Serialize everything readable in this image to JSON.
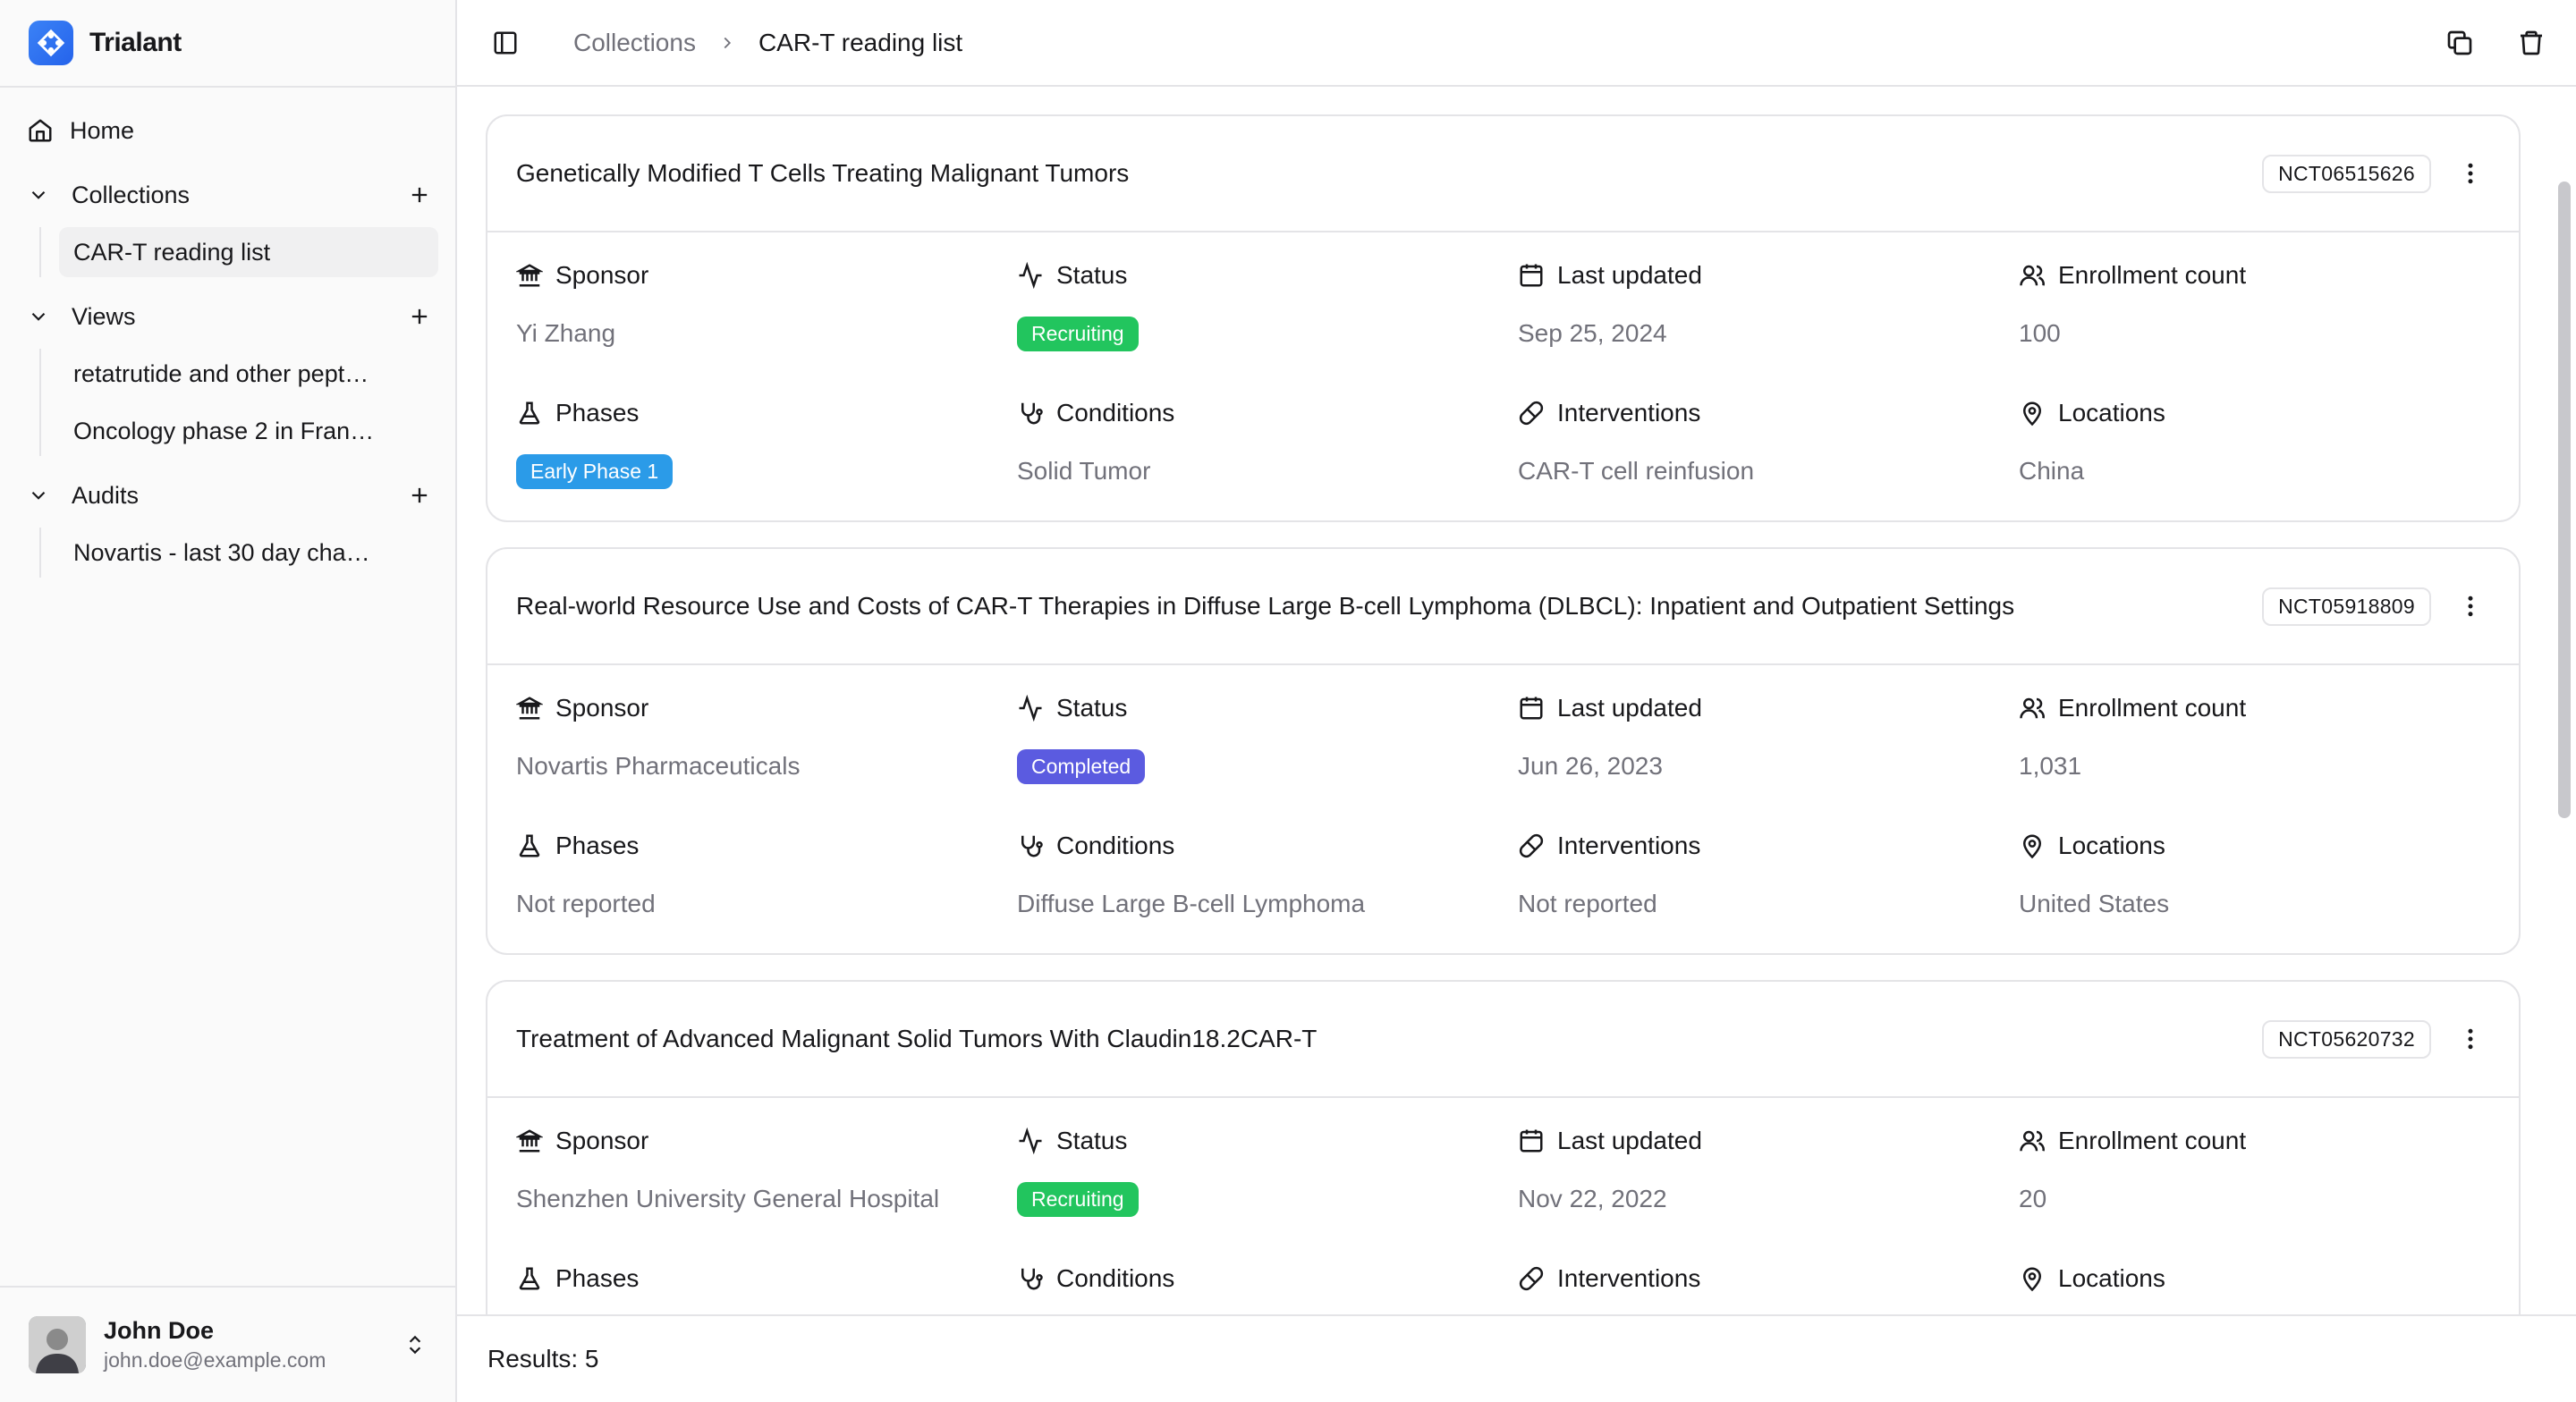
{
  "app": {
    "name": "Trialant"
  },
  "sidebar": {
    "home_label": "Home",
    "sections": [
      {
        "label": "Collections",
        "items": [
          "CAR-T reading list"
        ]
      },
      {
        "label": "Views",
        "items": [
          "retatrutide and other pept…",
          "Oncology phase 2 in Fran…"
        ]
      },
      {
        "label": "Audits",
        "items": [
          "Novartis - last 30 day cha…"
        ]
      }
    ]
  },
  "user": {
    "name": "John Doe",
    "email": "john.doe@example.com"
  },
  "breadcrumb": {
    "parent": "Collections",
    "current": "CAR-T reading list"
  },
  "labels": {
    "sponsor": "Sponsor",
    "status": "Status",
    "last_updated": "Last updated",
    "enrollment": "Enrollment count",
    "phases": "Phases",
    "conditions": "Conditions",
    "interventions": "Interventions",
    "locations": "Locations"
  },
  "trials": [
    {
      "title": "Genetically Modified T Cells Treating Malignant Tumors",
      "nct": "NCT06515626",
      "sponsor": "Yi Zhang",
      "status": "Recruiting",
      "status_color": "#22c55e",
      "last_updated": "Sep 25, 2024",
      "enrollment": "100",
      "phases": "Early Phase 1",
      "phases_color": "#2b9be8",
      "conditions": "Solid Tumor",
      "interventions": "CAR-T cell reinfusion",
      "locations": "China"
    },
    {
      "title": "Real-world Resource Use and Costs of CAR-T Therapies in Diffuse Large B-cell Lymphoma (DLBCL): Inpatient and Outpatient Settings",
      "nct": "NCT05918809",
      "sponsor": "Novartis Pharmaceuticals",
      "status": "Completed",
      "status_color": "#5b5be0",
      "last_updated": "Jun 26, 2023",
      "enrollment": "1,031",
      "phases": "Not reported",
      "conditions": "Diffuse Large B-cell Lymphoma",
      "interventions": "Not reported",
      "locations": "United States"
    },
    {
      "title": "Treatment of Advanced Malignant Solid Tumors With Claudin18.2CAR-T",
      "nct": "NCT05620732",
      "sponsor": "Shenzhen University General Hospital",
      "status": "Recruiting",
      "status_color": "#22c55e",
      "last_updated": "Nov 22, 2022",
      "enrollment": "20"
    }
  ],
  "footer": {
    "results": "Results: 5"
  }
}
